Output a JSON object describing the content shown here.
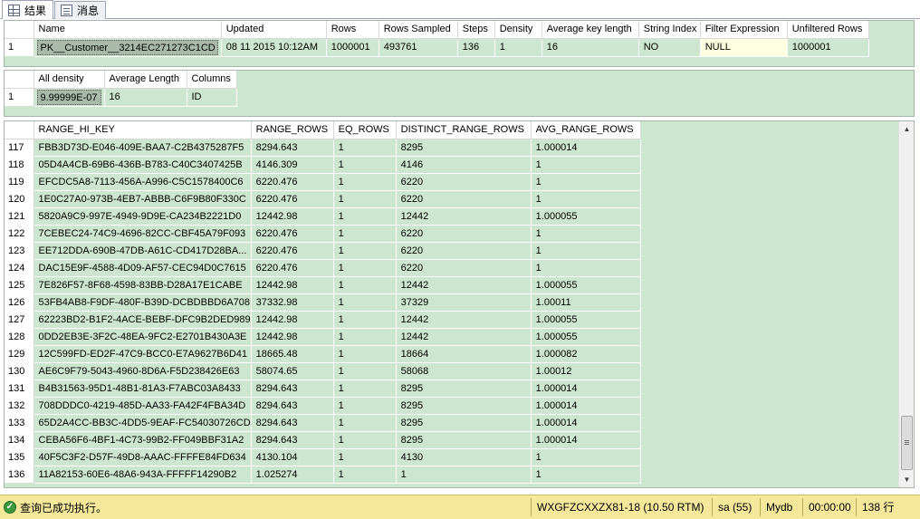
{
  "tabs": [
    {
      "label": "结果",
      "icon": "grid-icon"
    },
    {
      "label": "消息",
      "icon": "messages-icon"
    }
  ],
  "stats_header": {
    "columns": [
      "Name",
      "Updated",
      "Rows",
      "Rows Sampled",
      "Steps",
      "Density",
      "Average key length",
      "String Index",
      "Filter Expression",
      "Unfiltered Rows"
    ],
    "rows": [
      [
        "1",
        "PK__Customer__3214EC271273C1CD",
        "08 11 2015 10:12AM",
        "1000001",
        "493761",
        "136",
        "1",
        "16",
        "NO",
        "NULL",
        "1000001"
      ]
    ]
  },
  "density_vector": {
    "columns": [
      "All density",
      "Average Length",
      "Columns"
    ],
    "rows": [
      [
        "1",
        "9.99999E-07",
        "16",
        "ID"
      ]
    ]
  },
  "histogram": {
    "columns": [
      "RANGE_HI_KEY",
      "RANGE_ROWS",
      "EQ_ROWS",
      "DISTINCT_RANGE_ROWS",
      "AVG_RANGE_ROWS"
    ],
    "rows": [
      [
        "117",
        "FBB3D73D-E046-409E-BAA7-C2B4375287F5",
        "8294.643",
        "1",
        "8295",
        "1.000014"
      ],
      [
        "118",
        "05D4A4CB-69B6-436B-B783-C40C3407425B",
        "4146.309",
        "1",
        "4146",
        "1"
      ],
      [
        "119",
        "EFCDC5A8-7113-456A-A996-C5C1578400C6",
        "6220.476",
        "1",
        "6220",
        "1"
      ],
      [
        "120",
        "1E0C27A0-973B-4EB7-ABBB-C6F9B80F330C",
        "6220.476",
        "1",
        "6220",
        "1"
      ],
      [
        "121",
        "5820A9C9-997E-4949-9D9E-CA234B2221D0",
        "12442.98",
        "1",
        "12442",
        "1.000055"
      ],
      [
        "122",
        "7CEBEC24-74C9-4696-82CC-CBF45A79F093",
        "6220.476",
        "1",
        "6220",
        "1"
      ],
      [
        "123",
        "EE712DDA-690B-47DB-A61C-CD417D28BA...",
        "6220.476",
        "1",
        "6220",
        "1"
      ],
      [
        "124",
        "DAC15E9F-4588-4D09-AF57-CEC94D0C7615",
        "6220.476",
        "1",
        "6220",
        "1"
      ],
      [
        "125",
        "7E826F57-8F68-4598-83BB-D28A17E1CABE",
        "12442.98",
        "1",
        "12442",
        "1.000055"
      ],
      [
        "126",
        "53FB4AB8-F9DF-480F-B39D-DCBDBBD6A708",
        "37332.98",
        "1",
        "37329",
        "1.00011"
      ],
      [
        "127",
        "62223BD2-B1F2-4ACE-BEBF-DFC9B2DED989",
        "12442.98",
        "1",
        "12442",
        "1.000055"
      ],
      [
        "128",
        "0DD2EB3E-3F2C-48EA-9FC2-E2701B430A3E",
        "12442.98",
        "1",
        "12442",
        "1.000055"
      ],
      [
        "129",
        "12C599FD-ED2F-47C9-BCC0-E7A9627B6D41",
        "18665.48",
        "1",
        "18664",
        "1.000082"
      ],
      [
        "130",
        "AE6C9F79-5043-4960-8D6A-F5D238426E63",
        "58074.65",
        "1",
        "58068",
        "1.00012"
      ],
      [
        "131",
        "B4B31563-95D1-48B1-81A3-F7ABC03A8433",
        "8294.643",
        "1",
        "8295",
        "1.000014"
      ],
      [
        "132",
        "708DDDC0-4219-485D-AA33-FA42F4FBA34D",
        "8294.643",
        "1",
        "8295",
        "1.000014"
      ],
      [
        "133",
        "65D2A4CC-BB3C-4DD5-9EAF-FC54030726CD",
        "8294.643",
        "1",
        "8295",
        "1.000014"
      ],
      [
        "134",
        "CEBA56F6-4BF1-4C73-99B2-FF049BBF31A2",
        "8294.643",
        "1",
        "8295",
        "1.000014"
      ],
      [
        "135",
        "40F5C3F2-D57F-49D8-AAAC-FFFFE84FD634",
        "4130.104",
        "1",
        "4130",
        "1"
      ],
      [
        "136",
        "11A82153-60E6-48A6-943A-FFFFF14290B2",
        "1.025274",
        "1",
        "1",
        "1"
      ]
    ]
  },
  "status": {
    "message": "查询已成功执行。",
    "server": "WXGFZCXXZX81-18 (10.50 RTM)",
    "user": "sa (55)",
    "database": "Mydb",
    "elapsed": "00:00:00",
    "rows": "138 行"
  },
  "colors": {
    "grid_background": "#cde6cf",
    "status_bar": "#f5e89a",
    "null_highlight": "#ffffe1"
  }
}
